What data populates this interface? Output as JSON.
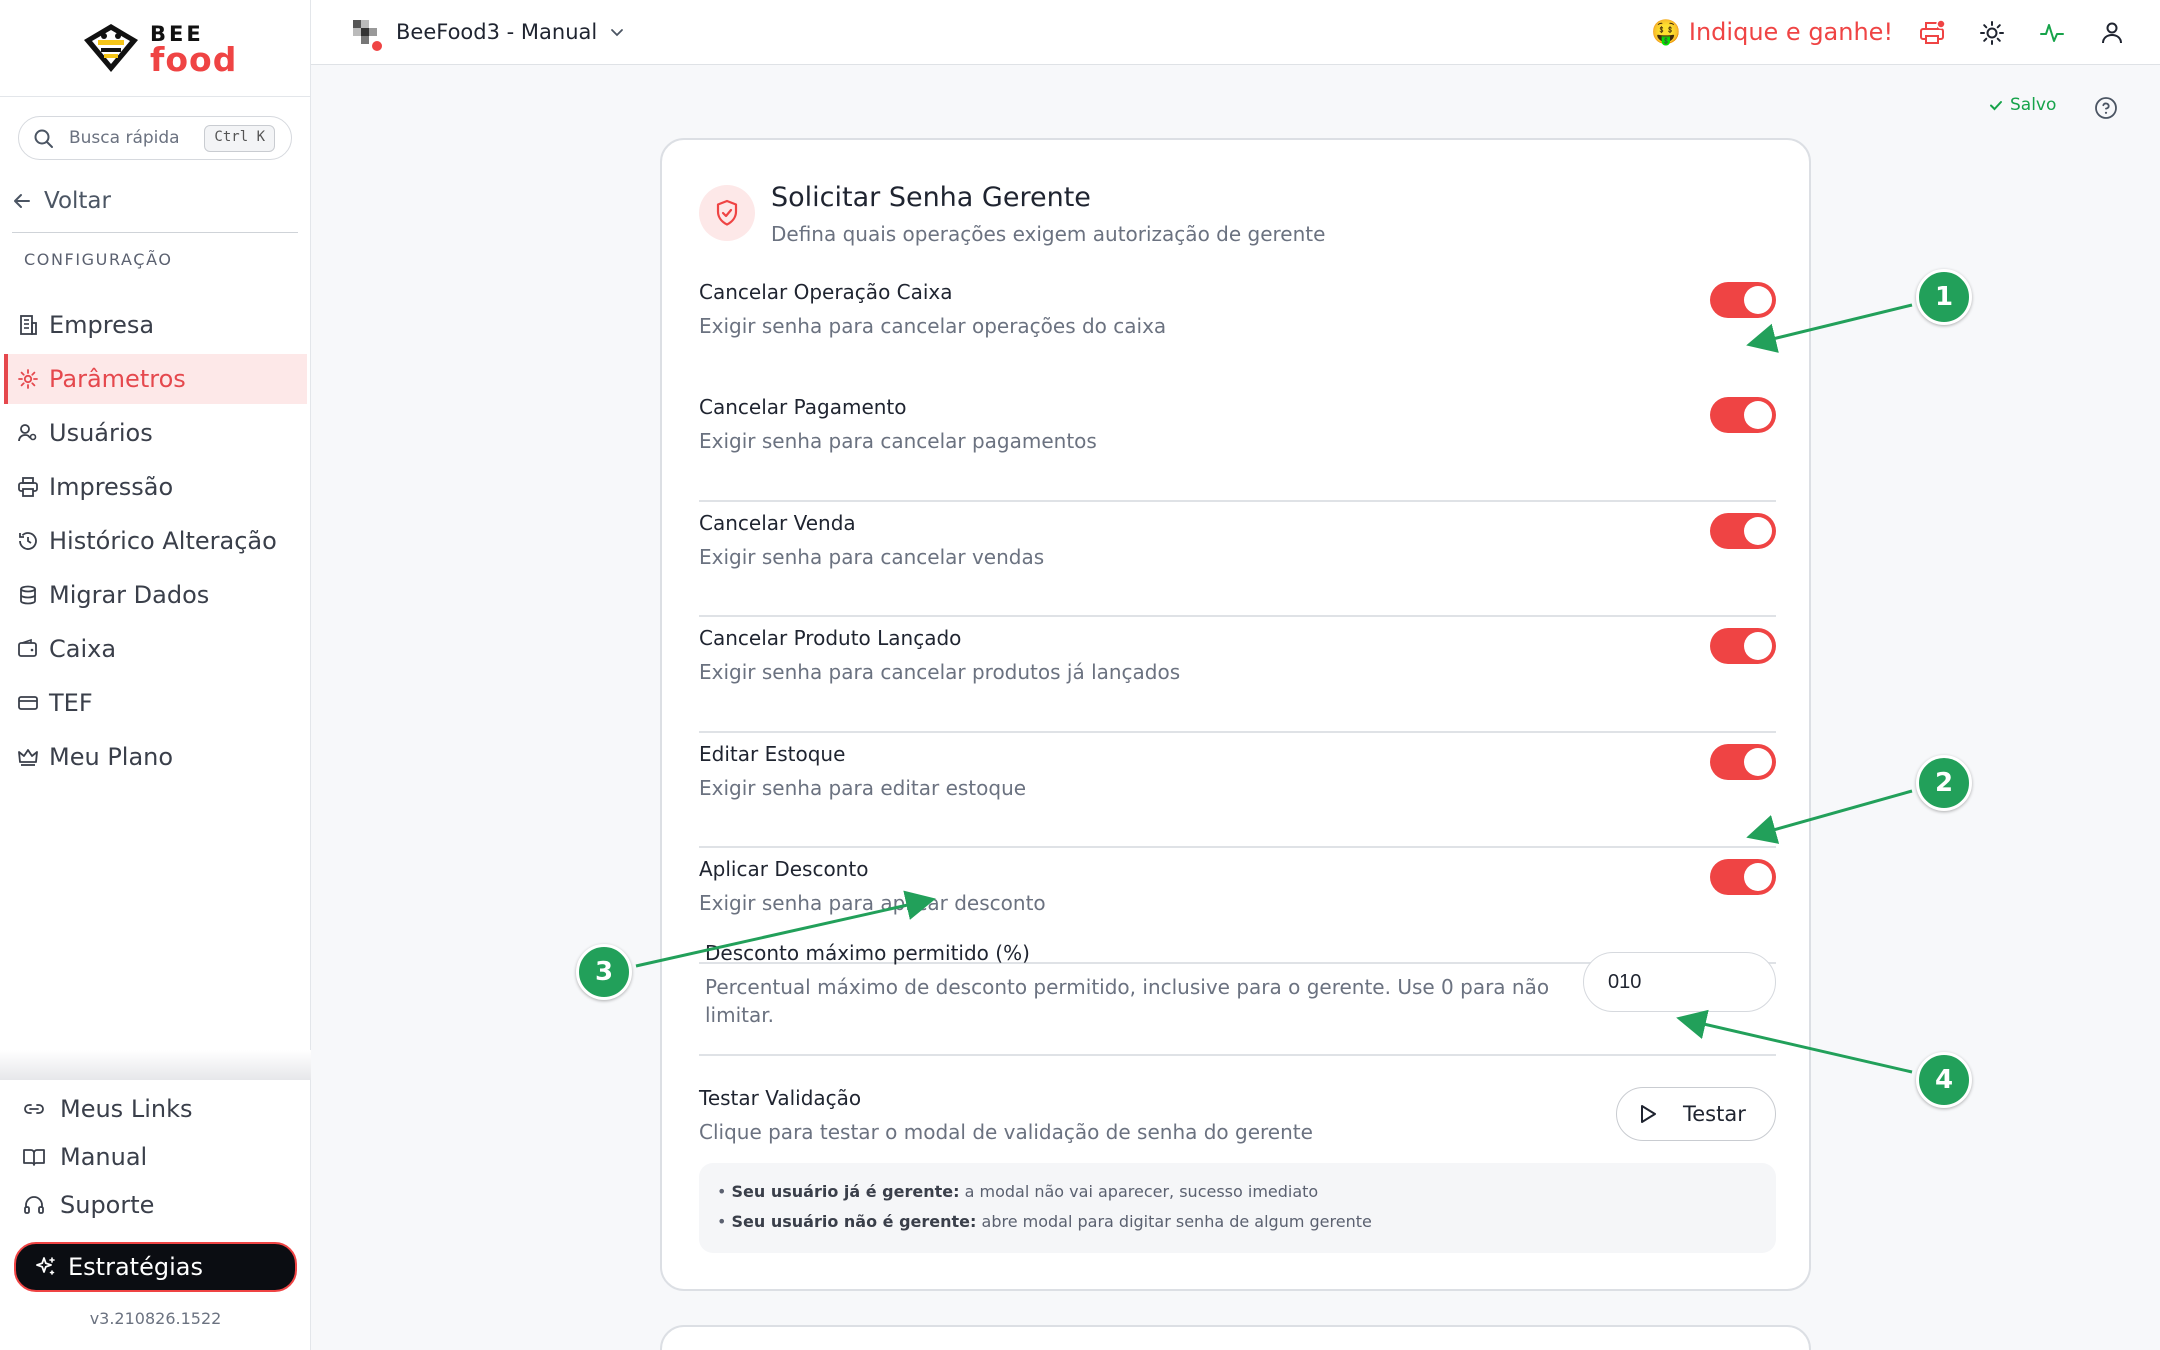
{
  "brand": {
    "line1": "BEE",
    "line2": "food"
  },
  "search": {
    "placeholder": "Busca rápida",
    "shortcut": "Ctrl K"
  },
  "sidebar": {
    "back_label": "Voltar",
    "section_title": "CONFIGURAÇÃO",
    "items": [
      {
        "label": "Empresa",
        "icon": "building-icon"
      },
      {
        "label": "Parâmetros",
        "icon": "gear-icon",
        "active": true
      },
      {
        "label": "Usuários",
        "icon": "users-icon"
      },
      {
        "label": "Impressão",
        "icon": "printer-icon"
      },
      {
        "label": "Histórico Alteração",
        "icon": "history-icon"
      },
      {
        "label": "Migrar Dados",
        "icon": "database-icon"
      },
      {
        "label": "Caixa",
        "icon": "wallet-icon"
      },
      {
        "label": "TEF",
        "icon": "card-icon"
      },
      {
        "label": "Meu Plano",
        "icon": "crown-icon"
      }
    ],
    "bottom": [
      {
        "label": "Meus Links",
        "icon": "link-icon"
      },
      {
        "label": "Manual",
        "icon": "book-icon"
      },
      {
        "label": "Suporte",
        "icon": "headset-icon"
      }
    ],
    "cta_label": "Estratégias",
    "version": "v3.210826.1522"
  },
  "topbar": {
    "app_title": "BeeFood3 - Manual",
    "promo_label": "Indique e ganhe!",
    "promo_emoji": "🤑"
  },
  "status": {
    "saved_label": "Salvo"
  },
  "settings": {
    "title": "Solicitar Senha Gerente",
    "subtitle": "Defina quais operações exigem autorização de gerente",
    "items": [
      {
        "title": "Cancelar Operação Caixa",
        "desc": "Exigir senha para cancelar operações do caixa",
        "enabled": true
      },
      {
        "title": "Cancelar Pagamento",
        "desc": "Exigir senha para cancelar pagamentos",
        "enabled": true
      },
      {
        "title": "Cancelar Venda",
        "desc": "Exigir senha para cancelar vendas",
        "enabled": true
      },
      {
        "title": "Cancelar Produto Lançado",
        "desc": "Exigir senha para cancelar produtos já lançados",
        "enabled": true
      },
      {
        "title": "Editar Estoque",
        "desc": "Exigir senha para editar estoque",
        "enabled": true
      },
      {
        "title": "Aplicar Desconto",
        "desc": "Exigir senha para aplicar desconto",
        "enabled": true
      }
    ],
    "max_discount": {
      "title": "Desconto máximo permitido (%)",
      "desc_line1": "Percentual máximo de desconto permitido, inclusive para o gerente. Use 0 para não",
      "desc_line2": "limitar.",
      "value": "010"
    },
    "test": {
      "title": "Testar Validação",
      "desc": "Clique para testar o modal de validação de senha do gerente",
      "button_label": "Testar"
    },
    "notes": [
      {
        "bold": "Seu usuário já é gerente:",
        "text": " a modal não vai aparecer, sucesso imediato"
      },
      {
        "bold": "Seu usuário não é gerente:",
        "text": " abre modal para digitar senha de algum gerente"
      }
    ]
  },
  "annotations": [
    {
      "label": "1"
    },
    {
      "label": "2"
    },
    {
      "label": "3"
    },
    {
      "label": "4"
    }
  ],
  "colors": {
    "accent": "#ef4444",
    "success": "#16a34a",
    "marker": "#22a05a"
  }
}
